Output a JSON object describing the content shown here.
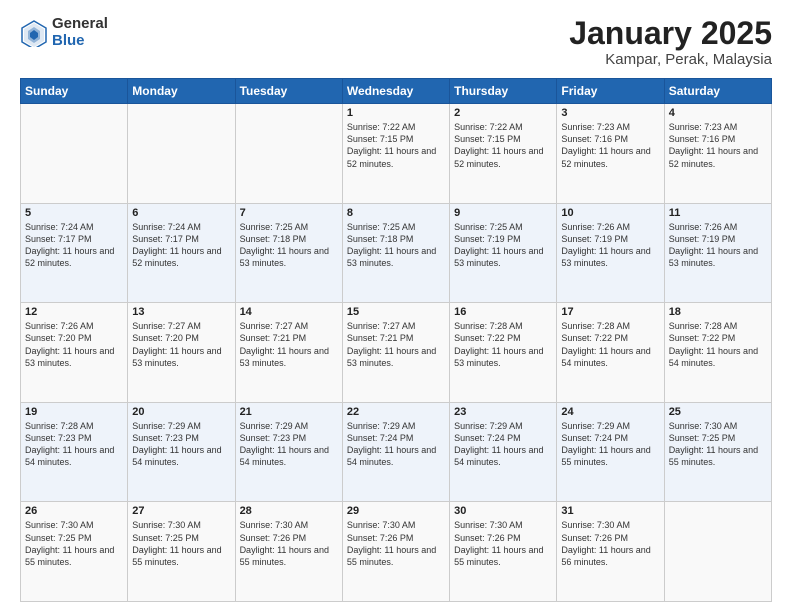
{
  "logo": {
    "general": "General",
    "blue": "Blue"
  },
  "title": "January 2025",
  "subtitle": "Kampar, Perak, Malaysia",
  "days_of_week": [
    "Sunday",
    "Monday",
    "Tuesday",
    "Wednesday",
    "Thursday",
    "Friday",
    "Saturday"
  ],
  "weeks": [
    [
      {
        "day": "",
        "info": ""
      },
      {
        "day": "",
        "info": ""
      },
      {
        "day": "",
        "info": ""
      },
      {
        "day": "1",
        "info": "Sunrise: 7:22 AM\nSunset: 7:15 PM\nDaylight: 11 hours\nand 52 minutes."
      },
      {
        "day": "2",
        "info": "Sunrise: 7:22 AM\nSunset: 7:15 PM\nDaylight: 11 hours\nand 52 minutes."
      },
      {
        "day": "3",
        "info": "Sunrise: 7:23 AM\nSunset: 7:16 PM\nDaylight: 11 hours\nand 52 minutes."
      },
      {
        "day": "4",
        "info": "Sunrise: 7:23 AM\nSunset: 7:16 PM\nDaylight: 11 hours\nand 52 minutes."
      }
    ],
    [
      {
        "day": "5",
        "info": "Sunrise: 7:24 AM\nSunset: 7:17 PM\nDaylight: 11 hours\nand 52 minutes."
      },
      {
        "day": "6",
        "info": "Sunrise: 7:24 AM\nSunset: 7:17 PM\nDaylight: 11 hours\nand 52 minutes."
      },
      {
        "day": "7",
        "info": "Sunrise: 7:25 AM\nSunset: 7:18 PM\nDaylight: 11 hours\nand 53 minutes."
      },
      {
        "day": "8",
        "info": "Sunrise: 7:25 AM\nSunset: 7:18 PM\nDaylight: 11 hours\nand 53 minutes."
      },
      {
        "day": "9",
        "info": "Sunrise: 7:25 AM\nSunset: 7:19 PM\nDaylight: 11 hours\nand 53 minutes."
      },
      {
        "day": "10",
        "info": "Sunrise: 7:26 AM\nSunset: 7:19 PM\nDaylight: 11 hours\nand 53 minutes."
      },
      {
        "day": "11",
        "info": "Sunrise: 7:26 AM\nSunset: 7:19 PM\nDaylight: 11 hours\nand 53 minutes."
      }
    ],
    [
      {
        "day": "12",
        "info": "Sunrise: 7:26 AM\nSunset: 7:20 PM\nDaylight: 11 hours\nand 53 minutes."
      },
      {
        "day": "13",
        "info": "Sunrise: 7:27 AM\nSunset: 7:20 PM\nDaylight: 11 hours\nand 53 minutes."
      },
      {
        "day": "14",
        "info": "Sunrise: 7:27 AM\nSunset: 7:21 PM\nDaylight: 11 hours\nand 53 minutes."
      },
      {
        "day": "15",
        "info": "Sunrise: 7:27 AM\nSunset: 7:21 PM\nDaylight: 11 hours\nand 53 minutes."
      },
      {
        "day": "16",
        "info": "Sunrise: 7:28 AM\nSunset: 7:22 PM\nDaylight: 11 hours\nand 53 minutes."
      },
      {
        "day": "17",
        "info": "Sunrise: 7:28 AM\nSunset: 7:22 PM\nDaylight: 11 hours\nand 54 minutes."
      },
      {
        "day": "18",
        "info": "Sunrise: 7:28 AM\nSunset: 7:22 PM\nDaylight: 11 hours\nand 54 minutes."
      }
    ],
    [
      {
        "day": "19",
        "info": "Sunrise: 7:28 AM\nSunset: 7:23 PM\nDaylight: 11 hours\nand 54 minutes."
      },
      {
        "day": "20",
        "info": "Sunrise: 7:29 AM\nSunset: 7:23 PM\nDaylight: 11 hours\nand 54 minutes."
      },
      {
        "day": "21",
        "info": "Sunrise: 7:29 AM\nSunset: 7:23 PM\nDaylight: 11 hours\nand 54 minutes."
      },
      {
        "day": "22",
        "info": "Sunrise: 7:29 AM\nSunset: 7:24 PM\nDaylight: 11 hours\nand 54 minutes."
      },
      {
        "day": "23",
        "info": "Sunrise: 7:29 AM\nSunset: 7:24 PM\nDaylight: 11 hours\nand 54 minutes."
      },
      {
        "day": "24",
        "info": "Sunrise: 7:29 AM\nSunset: 7:24 PM\nDaylight: 11 hours\nand 55 minutes."
      },
      {
        "day": "25",
        "info": "Sunrise: 7:30 AM\nSunset: 7:25 PM\nDaylight: 11 hours\nand 55 minutes."
      }
    ],
    [
      {
        "day": "26",
        "info": "Sunrise: 7:30 AM\nSunset: 7:25 PM\nDaylight: 11 hours\nand 55 minutes."
      },
      {
        "day": "27",
        "info": "Sunrise: 7:30 AM\nSunset: 7:25 PM\nDaylight: 11 hours\nand 55 minutes."
      },
      {
        "day": "28",
        "info": "Sunrise: 7:30 AM\nSunset: 7:26 PM\nDaylight: 11 hours\nand 55 minutes."
      },
      {
        "day": "29",
        "info": "Sunrise: 7:30 AM\nSunset: 7:26 PM\nDaylight: 11 hours\nand 55 minutes."
      },
      {
        "day": "30",
        "info": "Sunrise: 7:30 AM\nSunset: 7:26 PM\nDaylight: 11 hours\nand 55 minutes."
      },
      {
        "day": "31",
        "info": "Sunrise: 7:30 AM\nSunset: 7:26 PM\nDaylight: 11 hours\nand 56 minutes."
      },
      {
        "day": "",
        "info": ""
      }
    ]
  ]
}
